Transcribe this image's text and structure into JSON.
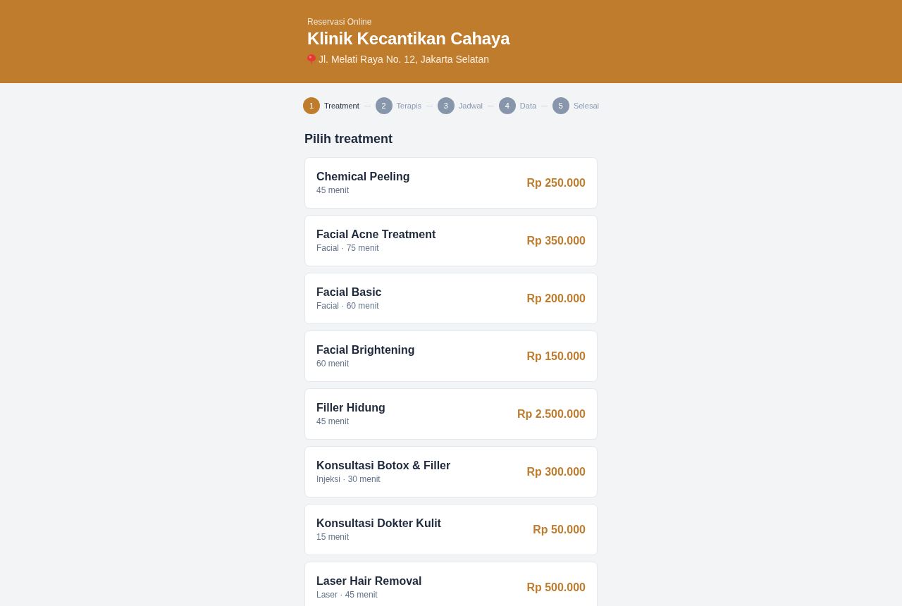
{
  "header": {
    "eyebrow": "Reservasi Online",
    "title": "Klinik Kecantikan Cahaya",
    "address": "Jl. Melati Raya No. 12, Jakarta Selatan"
  },
  "steps": [
    {
      "number": "1",
      "label": "Treatment",
      "selected": true
    },
    {
      "number": "2",
      "label": "Terapis",
      "selected": false
    },
    {
      "number": "3",
      "label": "Jadwal",
      "selected": false
    },
    {
      "number": "4",
      "label": "Data",
      "selected": false
    },
    {
      "number": "5",
      "label": "Selesai",
      "selected": false
    }
  ],
  "section_title": "Pilih treatment",
  "treatments": [
    {
      "name": "Chemical Peeling",
      "meta": "45 menit",
      "price": "Rp 250.000"
    },
    {
      "name": "Facial Acne Treatment",
      "meta": "Facial · 75 menit",
      "price": "Rp 350.000"
    },
    {
      "name": "Facial Basic",
      "meta": "Facial · 60 menit",
      "price": "Rp 200.000"
    },
    {
      "name": "Facial Brightening",
      "meta": "60 menit",
      "price": "Rp 150.000"
    },
    {
      "name": "Filler Hidung",
      "meta": "45 menit",
      "price": "Rp 2.500.000"
    },
    {
      "name": "Konsultasi Botox & Filler",
      "meta": "Injeksi · 30 menit",
      "price": "Rp 300.000"
    },
    {
      "name": "Konsultasi Dokter Kulit",
      "meta": "15 menit",
      "price": "Rp 50.000"
    },
    {
      "name": "Laser Hair Removal",
      "meta": "Laser · 45 menit",
      "price": "Rp 500.000"
    }
  ]
}
